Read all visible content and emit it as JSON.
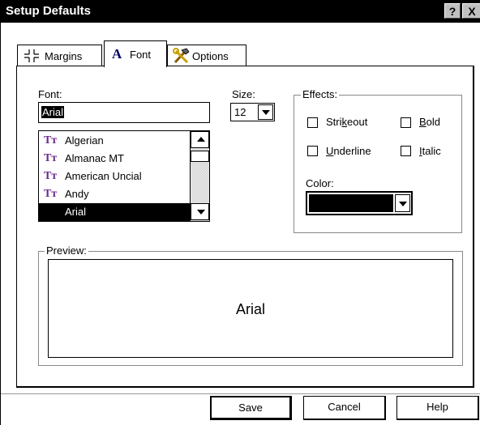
{
  "window": {
    "title": "Setup Defaults",
    "help_glyph": "?",
    "close_glyph": "X"
  },
  "tabs": [
    {
      "label": "Margins",
      "icon": "margins-icon"
    },
    {
      "label": "Font",
      "icon": "font-a-icon"
    },
    {
      "label": "Options",
      "icon": "tools-icon"
    }
  ],
  "font": {
    "label": "Font:",
    "value": "Arial",
    "list": [
      {
        "name": "Algerian",
        "icon": "truetype-icon",
        "selected": false
      },
      {
        "name": "Almanac MT",
        "icon": "truetype-icon",
        "selected": false
      },
      {
        "name": "American Uncial",
        "icon": "truetype-icon",
        "selected": false
      },
      {
        "name": "Andy",
        "icon": "truetype-icon",
        "selected": false
      },
      {
        "name": "Arial",
        "icon": "",
        "selected": true
      }
    ],
    "tt_glyph": "Tт"
  },
  "size": {
    "label": "Size:",
    "value": "12"
  },
  "effects": {
    "title": "Effects:",
    "strikeout": {
      "pre": "Stri",
      "ul": "k",
      "post": "eout"
    },
    "bold": {
      "pre": "",
      "ul": "B",
      "post": "old"
    },
    "underline": {
      "pre": "",
      "ul": "U",
      "post": "nderline"
    },
    "italic": {
      "pre": "",
      "ul": "I",
      "post": "talic"
    },
    "color_label": "Color:",
    "color_value": "#000000"
  },
  "preview": {
    "title": "Preview:",
    "text": "Arial"
  },
  "buttons": {
    "save": "Save",
    "cancel": "Cancel",
    "help": "Help"
  }
}
